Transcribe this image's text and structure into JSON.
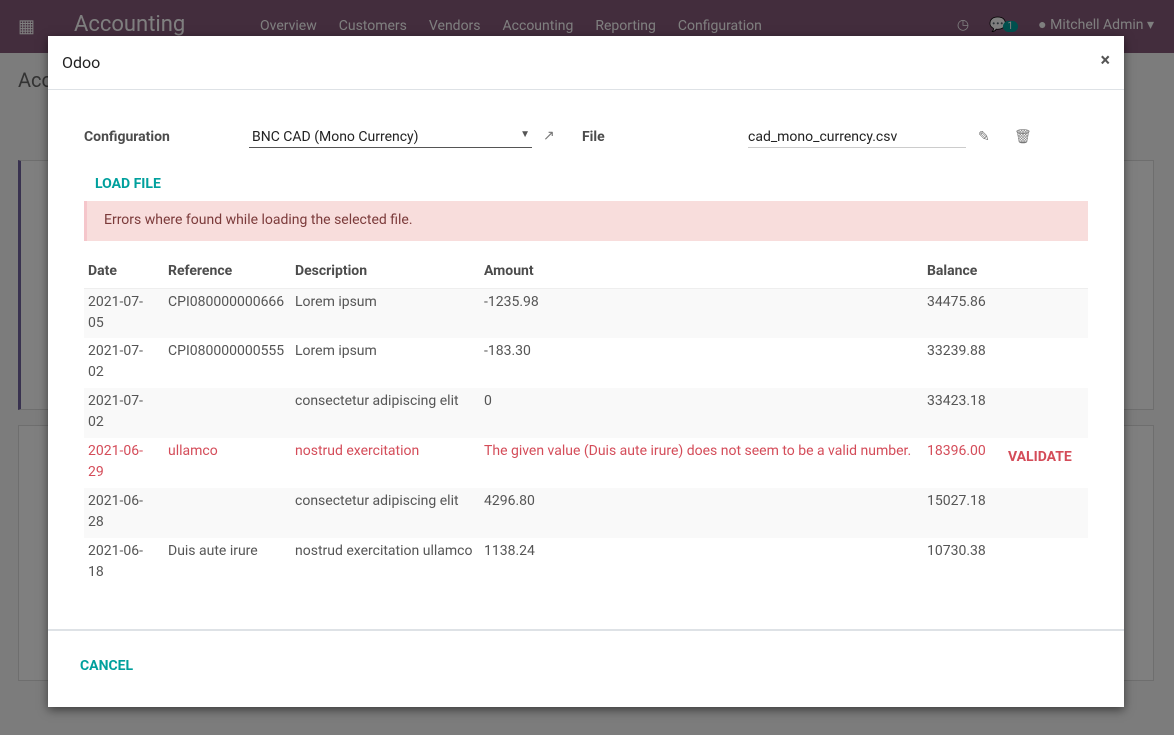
{
  "navbar": {
    "app_title": "Accounting",
    "menu": [
      "Overview",
      "Customers",
      "Vendors",
      "Accounting",
      "Reporting",
      "Configuration"
    ],
    "message_count": "1",
    "user": "Mitchell Admin"
  },
  "background": {
    "breadcrumb": "Acc"
  },
  "modal": {
    "title": "Odoo",
    "configuration_label": "Configuration",
    "configuration_value": "BNC CAD (Mono Currency)",
    "file_label": "File",
    "file_value": "cad_mono_currency.csv",
    "load_file": "LOAD FILE",
    "error_message": "Errors where found while loading the selected file.",
    "columns": [
      "Date",
      "Reference",
      "Description",
      "Amount",
      "Balance"
    ],
    "rows": [
      {
        "date": "2021-07-05",
        "reference": "CPI080000000666",
        "description": "Lorem ipsum",
        "amount": "-1235.98",
        "balance": "34475.86",
        "error": false
      },
      {
        "date": "2021-07-02",
        "reference": "CPI080000000555",
        "description": "Lorem ipsum",
        "amount": "-183.30",
        "balance": "33239.88",
        "error": false
      },
      {
        "date": "2021-07-02",
        "reference": "",
        "description": "consectetur adipiscing elit",
        "amount": "0",
        "balance": "33423.18",
        "error": false
      },
      {
        "date": "2021-06-29",
        "reference": "ullamco",
        "description": "nostrud exercitation",
        "amount": "The given value (Duis aute irure) does not seem to be a valid number.",
        "balance": "18396.00",
        "error": true,
        "action": "VALIDATE"
      },
      {
        "date": "2021-06-28",
        "reference": "",
        "description": "consectetur adipiscing elit",
        "amount": "4296.80",
        "balance": "15027.18",
        "error": false
      },
      {
        "date": "2021-06-18",
        "reference": "Duis aute irure",
        "description": "nostrud exercitation ullamco",
        "amount": "1138.24",
        "balance": "10730.38",
        "error": false
      }
    ],
    "cancel": "CANCEL"
  },
  "colors": {
    "brand": "#875a7b",
    "accent": "#00a09d",
    "error": "#d44c59",
    "alert_bg": "#f8dddc"
  }
}
